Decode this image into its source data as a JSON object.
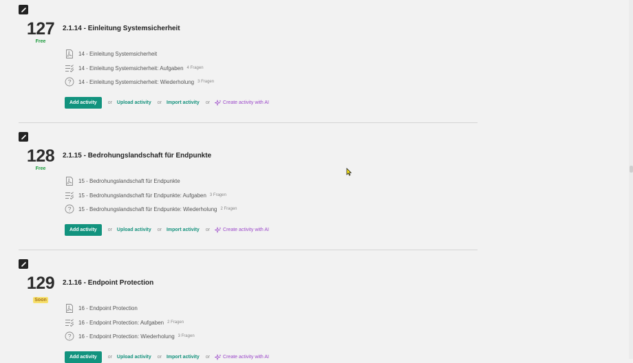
{
  "sections": [
    {
      "number": "127",
      "badge": "Free",
      "title": "2.1.14 - Einleitung Systemsicherheit",
      "activities": [
        {
          "icon": "pdf-icon",
          "label": "14 - Einleitung Systemsicherheit",
          "count": ""
        },
        {
          "icon": "checklist-icon",
          "label": "14 - Einleitung Systemsicherheit: Aufgaben",
          "count": "4 Fragen"
        },
        {
          "icon": "question-icon",
          "label": "14 - Einleitung Systemsicherheit: Wiederholung",
          "count": "3 Fragen"
        }
      ]
    },
    {
      "number": "128",
      "badge": "Free",
      "title": "2.1.15 - Bedrohungslandschaft für Endpunkte",
      "activities": [
        {
          "icon": "pdf-icon",
          "label": "15 - Bedrohungslandschaft für Endpunkte",
          "count": ""
        },
        {
          "icon": "checklist-icon",
          "label": "15 - Bedrohungslandschaft für Endpunkte: Aufgaben",
          "count": "3 Fragen"
        },
        {
          "icon": "question-icon",
          "label": "15 - Bedrohungslandschaft für Endpunkte: Wiederholung",
          "count": "2 Fragen"
        }
      ]
    },
    {
      "number": "129",
      "badge": "Soon",
      "title": "2.1.16 - Endpoint Protection",
      "activities": [
        {
          "icon": "pdf-icon",
          "label": "16 - Endpoint Protection",
          "count": ""
        },
        {
          "icon": "checklist-icon",
          "label": "16 - Endpoint Protection: Aufgaben",
          "count": "2 Fragen"
        },
        {
          "icon": "question-icon",
          "label": "16 - Endpoint Protection: Wiederholung",
          "count": "3 Fragen"
        }
      ]
    }
  ],
  "actions": {
    "add": "Add activity",
    "or": "or",
    "upload": "Upload activity",
    "import": "Import activity",
    "ai": "Create activity with AI"
  },
  "colors": {
    "accent": "#12937e",
    "ai": "#9b47c9",
    "free": "#1a9a3b",
    "soon_bg": "#f7e06d"
  }
}
